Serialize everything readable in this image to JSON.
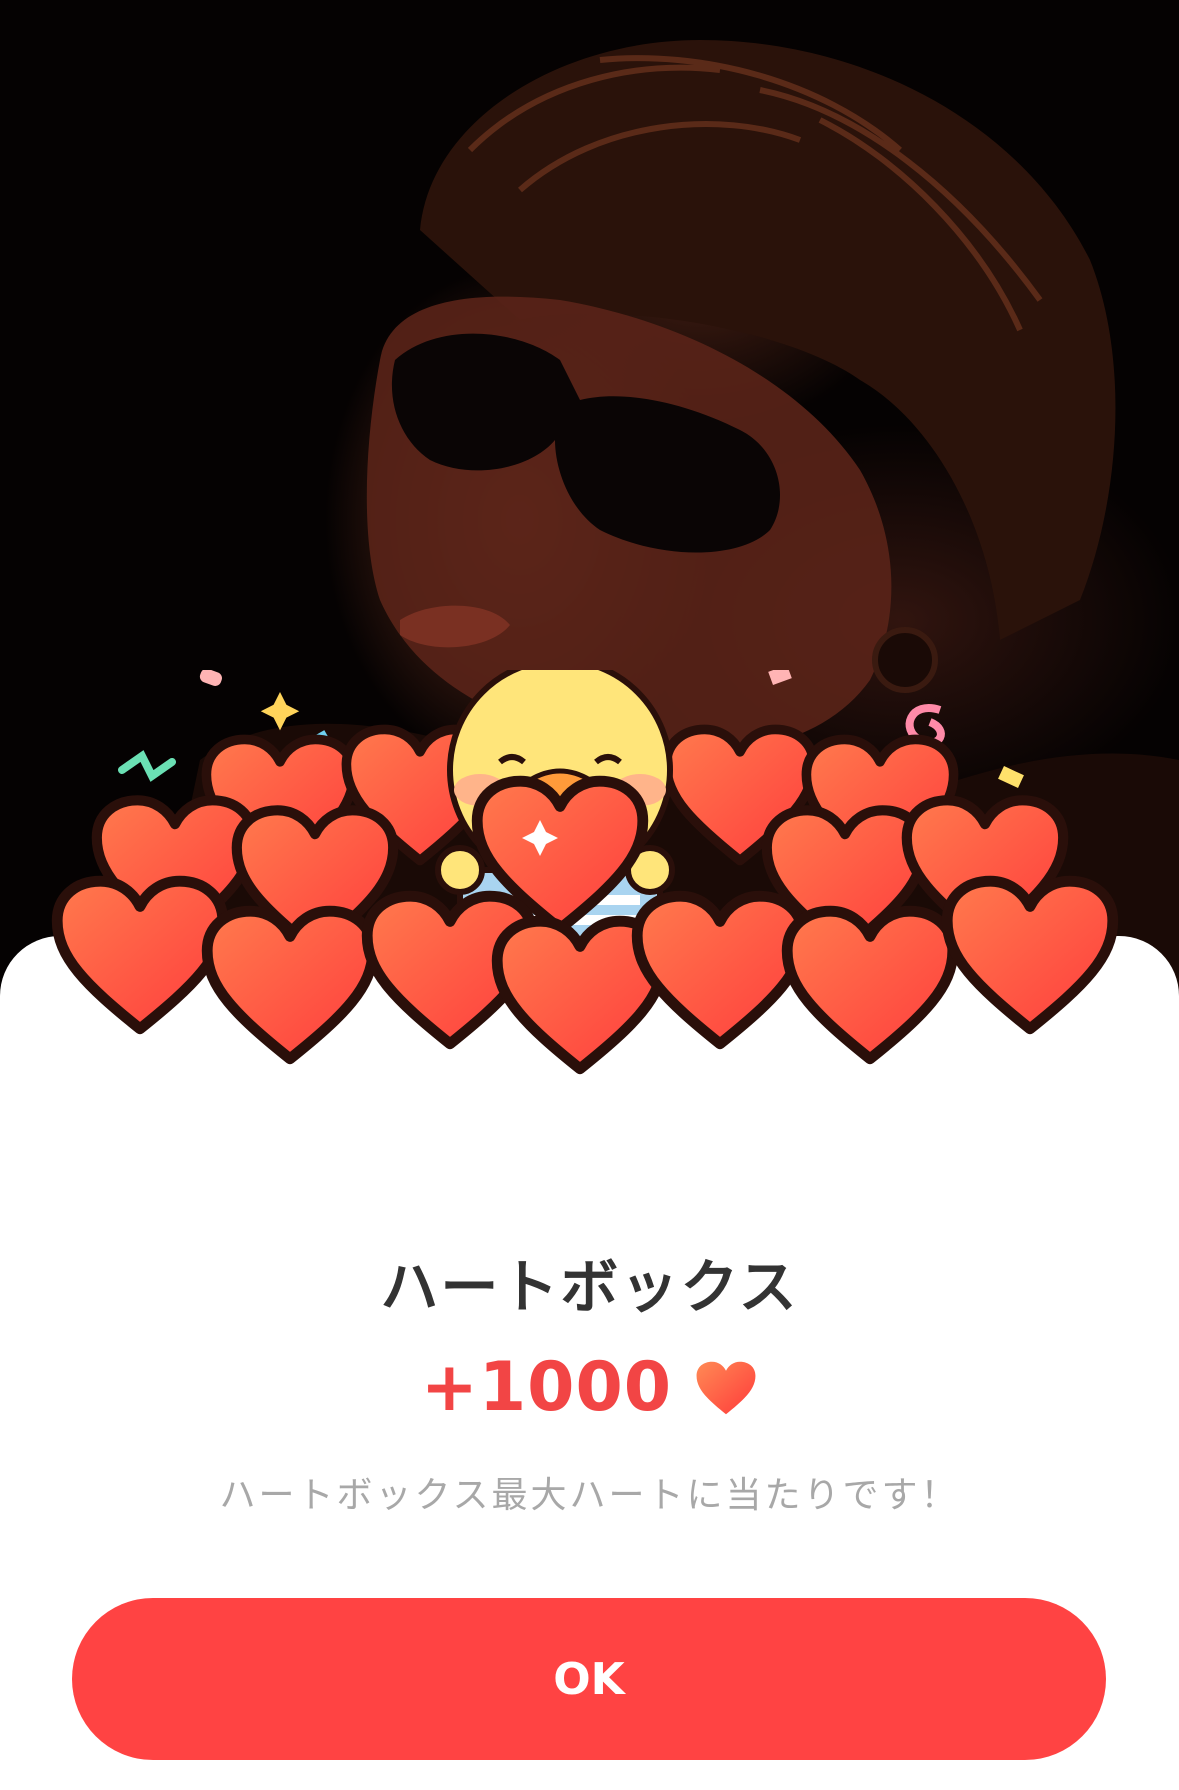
{
  "dialog": {
    "title": "ハートボックス",
    "amount": "+1000",
    "message": "ハートボックス最大ハートに当たりです！",
    "ok_label": "OK"
  },
  "icons": {
    "heart": "heart-icon",
    "mascot": "chick-mascot"
  },
  "colors": {
    "accent": "#ff4343",
    "amount": "#f24545",
    "title": "#333333",
    "message": "#a8a8a8"
  }
}
